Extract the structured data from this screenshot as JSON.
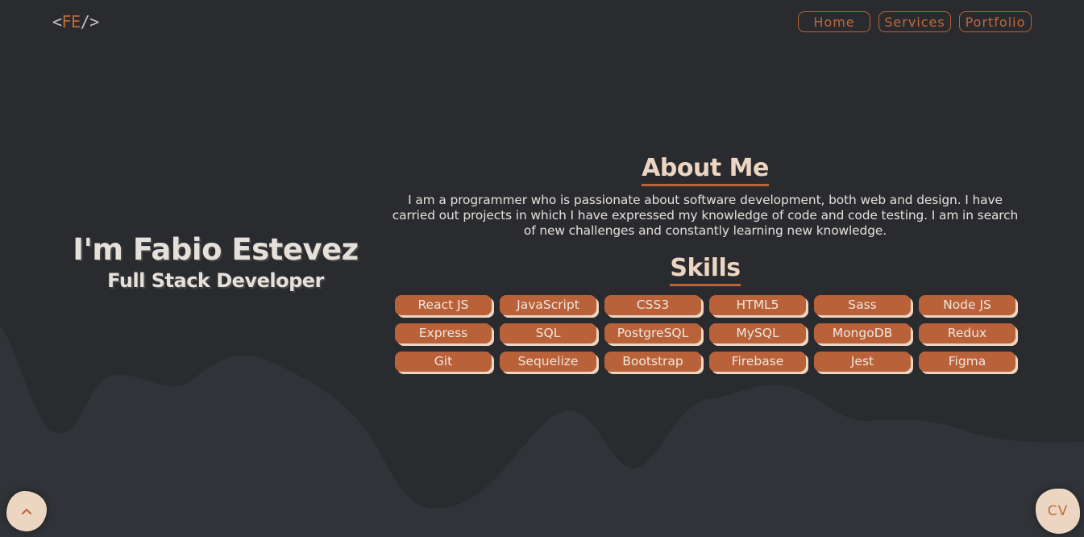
{
  "header": {
    "logo": {
      "open": "<",
      "initials": "FE",
      "close": "/>"
    },
    "nav": [
      {
        "label": "Home"
      },
      {
        "label": "Services"
      },
      {
        "label": "Portfolio"
      }
    ]
  },
  "hero": {
    "name": "I'm Fabio Estevez",
    "role": "Full Stack Developer"
  },
  "about": {
    "title": "About Me",
    "text": "I am a programmer who is passionate about software development, both web and design. I have carried out projects in which I have expressed my knowledge of code and code testing. I am in search of new challenges and constantly learning new knowledge."
  },
  "skills": {
    "title": "Skills",
    "items": [
      "React JS",
      "JavaScript",
      "CSS3",
      "HTML5",
      "Sass",
      "Node JS",
      "Express",
      "SQL",
      "PostgreSQL",
      "MySQL",
      "MongoDB",
      "Redux",
      "Git",
      "Sequelize",
      "Bootstrap",
      "Firebase",
      "Jest",
      "Figma"
    ]
  },
  "floating": {
    "scroll_up_icon": "chevron-up-icon",
    "cv_label": "CV"
  },
  "colors": {
    "background": "#2a2b2f",
    "wave": "#303337",
    "accent": "#b9623a",
    "cream": "#ecd6c2",
    "text": "#e6e0da"
  }
}
